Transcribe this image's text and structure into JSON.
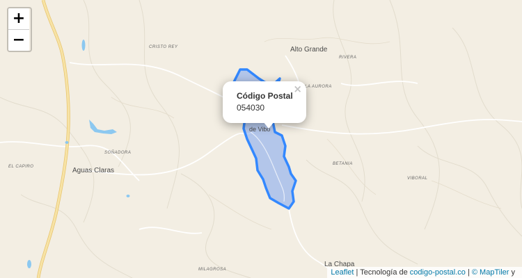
{
  "map": {
    "zoom_in_label": "+",
    "zoom_out_label": "−",
    "places": {
      "alto_grande": "Alto Grande",
      "aguas_claras": "Aguas Claras",
      "la_chapa": "La Chapa",
      "cristo_rey": "CRISTO REY",
      "rivera": "RIVERA",
      "la_aurora": "LA AURORA",
      "sonadora": "SOÑADORA",
      "el_capiro": "EL CAPIRO",
      "betania": "BETANIA",
      "viboral": "VIBORAL",
      "milagrosa": "MILAGROSA",
      "vibo_partial": "de Vibo"
    },
    "colors": {
      "background": "#f3eee3",
      "road_major": "#f7e3a6",
      "road_major_edge": "#e8c46c",
      "water": "#8cc8f0",
      "polygon_stroke": "#3388ff",
      "polygon_fill": "#7ea6f0"
    }
  },
  "popup": {
    "title": "Código Postal",
    "code": "054030",
    "close_label": "×"
  },
  "attribution": {
    "leaflet": "Leaflet",
    "separator": "|",
    "tech_text": "Tecnología de",
    "site": "codigo-postal.co",
    "maptiler": "© MapTiler",
    "tail": "y"
  }
}
